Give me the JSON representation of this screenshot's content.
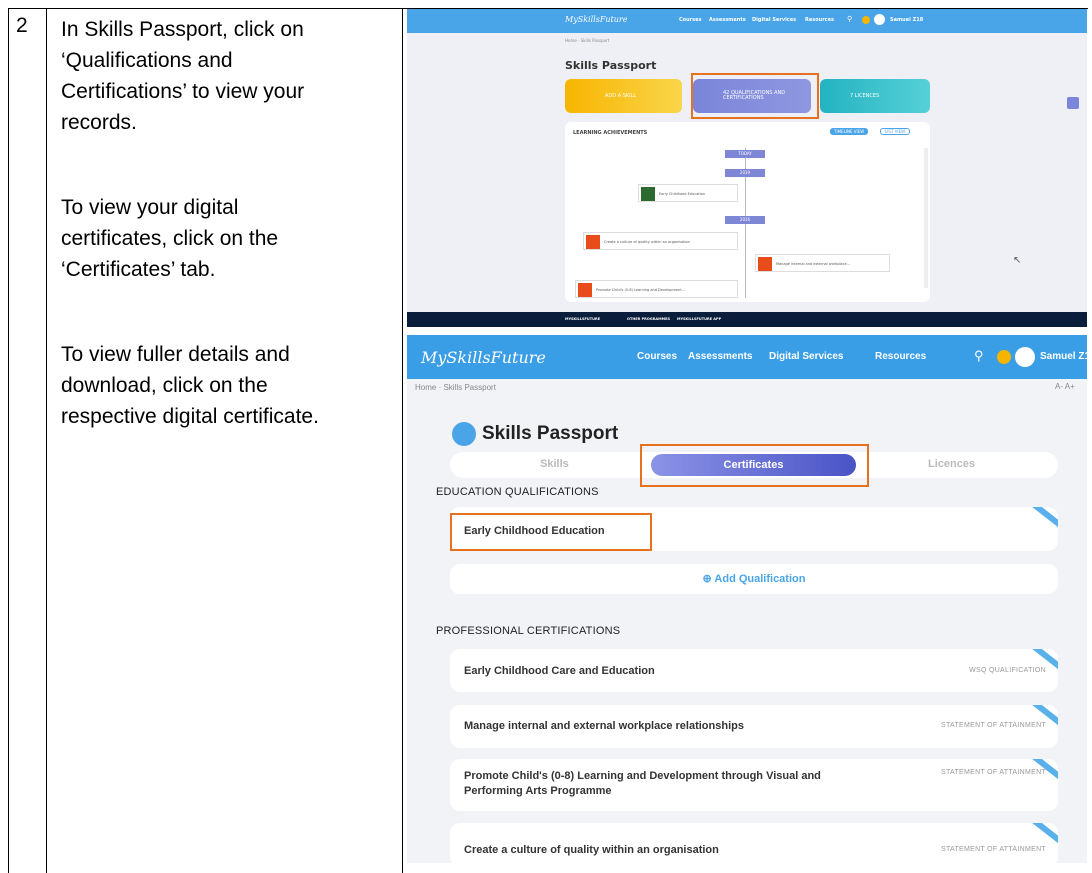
{
  "step": {
    "number": "2"
  },
  "instructions": {
    "para1": [
      "In Skills Passport, click on",
      "‘Qualifications and",
      "Certifications’ to view your",
      "records."
    ],
    "para2": [
      "To view your digital",
      "certificates, click on the",
      "‘Certificates’ tab."
    ],
    "para3": [
      "To view fuller details and",
      "download, click on the",
      "respective digital certificate."
    ]
  },
  "screenshot_top": {
    "logo": "MySkillsFuture",
    "menu": [
      "Courses",
      "Assessments",
      "Digital Services",
      "Resources"
    ],
    "user": "Samuel Z18",
    "breadcrumb": "Home · Skills Passport",
    "title": "Skills Passport",
    "cards": [
      "ADD A SKILL",
      "42 QUALIFICATIONS AND CERTIFICATIONS",
      "7 LICENCES"
    ],
    "learning_header": "LEARNING ACHIEVEMENTS",
    "views": [
      "TIMELINE VIEW",
      "LIST VIEW"
    ],
    "years": [
      "TODAY",
      "2019",
      "2016"
    ],
    "timeline": [
      "Early Childhood Education",
      "Create a culture of quality within an organisation",
      "Manage internal and external workplace...",
      "Promote Child's (0-8) Learning and Development..."
    ],
    "footer": [
      "MYSKILLSFUTURE",
      "OTHER PROGRAMMES",
      "MYSKILLSFUTURE APP"
    ]
  },
  "screenshot_bottom": {
    "logo": "MySkillsFuture",
    "menu": [
      "Courses",
      "Assessments",
      "Digital Services",
      "Resources"
    ],
    "user": "Samuel Z18",
    "breadcrumb": "Home · Skills Passport",
    "font_size": "A-  A+",
    "title": "Skills Passport",
    "tabs": {
      "skills": "Skills",
      "certificates": "Certificates",
      "licences": "Licences"
    },
    "education_header": "EDUCATION QUALIFICATIONS",
    "education_items": [
      {
        "title": "Early Childhood Education"
      }
    ],
    "add_qualification": "Add Qualification",
    "professional_header": "PROFESSIONAL CERTIFICATIONS",
    "professional_items": [
      {
        "title": "Early Childhood Care and Education",
        "tag": "WSQ QUALIFICATION"
      },
      {
        "title": "Manage internal and external workplace relationships",
        "tag": "STATEMENT OF ATTAINMENT"
      },
      {
        "title": "Promote Child's (0-8) Learning and Development through Visual and",
        "title2": "Performing Arts Programme",
        "tag": "STATEMENT OF ATTAINMENT"
      },
      {
        "title": "Create a culture of quality within an organisation",
        "tag": "STATEMENT OF ATTAINMENT"
      }
    ]
  },
  "colors": {
    "nav_blue": "#3a9ee6",
    "highlight_orange": "#e8711f",
    "tab_purple": "#4a54c6"
  }
}
